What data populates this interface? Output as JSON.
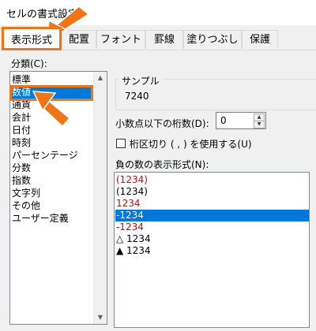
{
  "window": {
    "title": "セルの書式設定"
  },
  "tabs": [
    {
      "label": "表示形式"
    },
    {
      "label": "配置"
    },
    {
      "label": "フォント"
    },
    {
      "label": "罫線"
    },
    {
      "label": "塗りつぶし"
    },
    {
      "label": "保護"
    }
  ],
  "category": {
    "label": "分類(C):",
    "items": [
      "標準",
      "数値",
      "通貨",
      "会計",
      "日付",
      "時刻",
      "パーセンテージ",
      "分数",
      "指数",
      "文字列",
      "その他",
      "ユーザー定義"
    ],
    "selected_index": 1
  },
  "sample": {
    "label": "サンプル",
    "value": "7240"
  },
  "decimal_places": {
    "label": "小数点以下の桁数(D):",
    "value": "0"
  },
  "separator": {
    "label": "桁区切り ( , ) を使用する(U)",
    "checked": false
  },
  "negative_format": {
    "label": "負の数の表示形式(N):",
    "items": [
      {
        "text": "(1234)",
        "color": "#e00000"
      },
      {
        "text": "(1234)",
        "color": "#000000"
      },
      {
        "text": "1234",
        "color": "#e00000"
      },
      {
        "text": "-1234",
        "color": "#000000"
      },
      {
        "text": "-1234",
        "color": "#e00000"
      },
      {
        "text": "△ 1234",
        "color": "#000000"
      },
      {
        "text": "▲ 1234",
        "color": "#000000"
      }
    ],
    "selected_index": 3
  },
  "colors": {
    "accent": "#f07418",
    "selection": "#0078d7",
    "negative_red": "#e00000"
  }
}
